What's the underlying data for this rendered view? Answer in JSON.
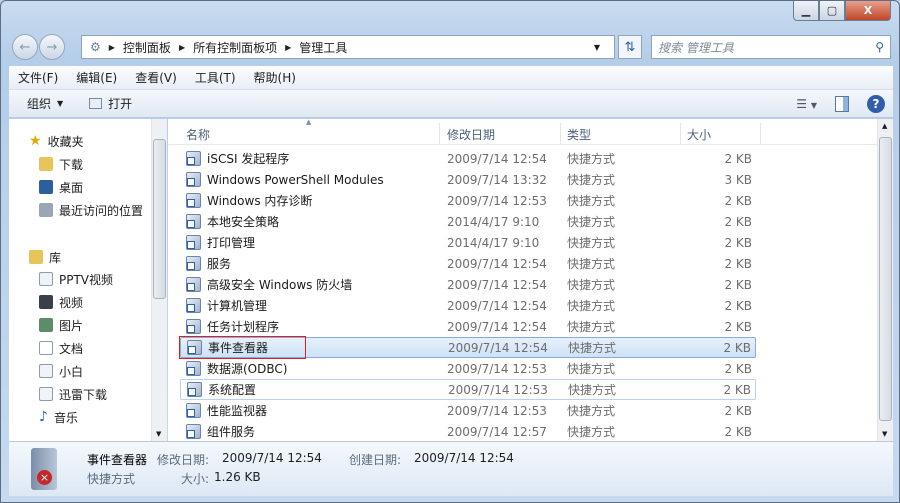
{
  "window": {
    "controls": [
      "minimize",
      "maximize",
      "close"
    ]
  },
  "address": {
    "crumbs": [
      "控制面板",
      "所有控制面板项",
      "管理工具"
    ]
  },
  "search": {
    "placeholder": "搜索 管理工具"
  },
  "menu": [
    "文件(F)",
    "编辑(E)",
    "查看(V)",
    "工具(T)",
    "帮助(H)"
  ],
  "toolbar": {
    "organize": "组织",
    "open": "打开"
  },
  "sidebar": {
    "favorites": {
      "label": "收藏夹",
      "items": [
        "下载",
        "桌面",
        "最近访问的位置"
      ]
    },
    "libraries": {
      "label": "库",
      "items": [
        "PPTV视频",
        "视频",
        "图片",
        "文档",
        "小白",
        "迅雷下载",
        "音乐"
      ]
    }
  },
  "columns": {
    "name": "名称",
    "date": "修改日期",
    "type": "类型",
    "size": "大小"
  },
  "files": [
    {
      "name": "iSCSI 发起程序",
      "date": "2009/7/14 12:54",
      "type": "快捷方式",
      "size": "2 KB"
    },
    {
      "name": "Windows PowerShell Modules",
      "date": "2009/7/14 13:32",
      "type": "快捷方式",
      "size": "3 KB"
    },
    {
      "name": "Windows 内存诊断",
      "date": "2009/7/14 12:53",
      "type": "快捷方式",
      "size": "2 KB"
    },
    {
      "name": "本地安全策略",
      "date": "2014/4/17 9:10",
      "type": "快捷方式",
      "size": "2 KB"
    },
    {
      "name": "打印管理",
      "date": "2014/4/17 9:10",
      "type": "快捷方式",
      "size": "2 KB"
    },
    {
      "name": "服务",
      "date": "2009/7/14 12:54",
      "type": "快捷方式",
      "size": "2 KB"
    },
    {
      "name": "高级安全 Windows 防火墙",
      "date": "2009/7/14 12:54",
      "type": "快捷方式",
      "size": "2 KB"
    },
    {
      "name": "计算机管理",
      "date": "2009/7/14 12:54",
      "type": "快捷方式",
      "size": "2 KB"
    },
    {
      "name": "任务计划程序",
      "date": "2009/7/14 12:54",
      "type": "快捷方式",
      "size": "2 KB"
    },
    {
      "name": "事件查看器",
      "date": "2009/7/14 12:54",
      "type": "快捷方式",
      "size": "2 KB"
    },
    {
      "name": "数据源(ODBC)",
      "date": "2009/7/14 12:53",
      "type": "快捷方式",
      "size": "2 KB"
    },
    {
      "name": "系统配置",
      "date": "2009/7/14 12:53",
      "type": "快捷方式",
      "size": "2 KB"
    },
    {
      "name": "性能监视器",
      "date": "2009/7/14 12:53",
      "type": "快捷方式",
      "size": "2 KB"
    },
    {
      "name": "组件服务",
      "date": "2009/7/14 12:57",
      "type": "快捷方式",
      "size": "2 KB"
    }
  ],
  "selected_index": 9,
  "details": {
    "name": "事件查看器",
    "type": "快捷方式",
    "modified_label": "修改日期:",
    "modified": "2009/7/14 12:54",
    "created_label": "创建日期:",
    "created": "2009/7/14 12:54",
    "size_label": "大小:",
    "size": "1.26 KB"
  }
}
